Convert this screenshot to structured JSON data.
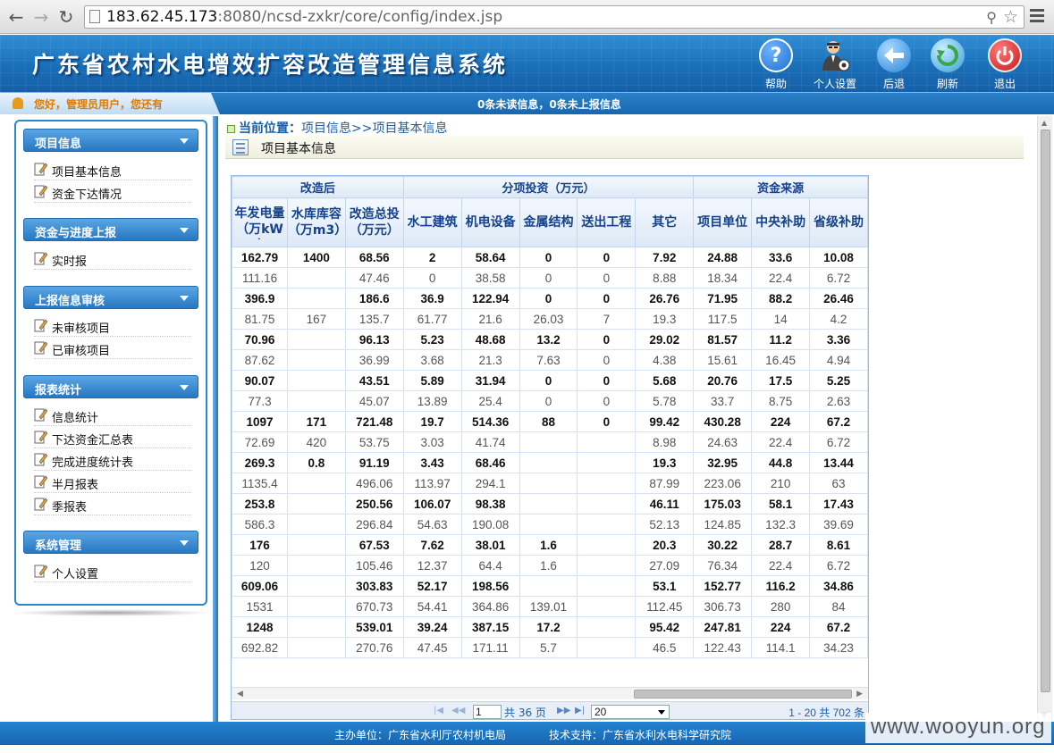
{
  "browser": {
    "url_host": "183.62.45.173",
    "url_rest": ":8080/ncsd-zxkr/core/config/index.jsp"
  },
  "header": {
    "title": "广东省农村水电增效扩容改造管理信息系统",
    "buttons": [
      {
        "label": "帮助",
        "icon": "help-icon"
      },
      {
        "label": "个人设置",
        "icon": "user-settings-icon"
      },
      {
        "label": "后退",
        "icon": "back-arrow-icon"
      },
      {
        "label": "刷新",
        "icon": "refresh-icon"
      },
      {
        "label": "退出",
        "icon": "power-icon"
      }
    ],
    "colors": {
      "help": "#1f6fd0",
      "settings": "#444444",
      "back": "#2a86d8",
      "refresh": "#3aa0d8",
      "exit": "#d42020"
    }
  },
  "userbar": {
    "greeting": "您好，管理员用户，您还有",
    "notice": "0条未读信息，0条未上报信息"
  },
  "sidebar": {
    "sections": [
      {
        "title": "项目信息",
        "items": [
          "项目基本信息",
          "资金下达情况"
        ]
      },
      {
        "title": "资金与进度上报",
        "items": [
          "实时报"
        ]
      },
      {
        "title": "上报信息审核",
        "items": [
          "未审核项目",
          "已审核项目"
        ]
      },
      {
        "title": "报表统计",
        "items": [
          "信息统计",
          "下达资金汇总表",
          "完成进度统计表",
          "半月报表",
          "季报表"
        ]
      },
      {
        "title": "系统管理",
        "items": [
          "个人设置"
        ]
      }
    ]
  },
  "main": {
    "breadcrumb_label": "当前位置：",
    "breadcrumb_path": "项目信息>>项目基本信息",
    "page_title": "项目基本信息"
  },
  "table": {
    "group_headers": [
      {
        "label": "改造后",
        "span": 3
      },
      {
        "label": "分项投资（万元）",
        "span": 5
      },
      {
        "label": "资金来源",
        "span": 3
      }
    ],
    "columns": [
      "年发电量（万kWh）",
      "水库库容（万m3）",
      "改造总投（万元）",
      "水工建筑",
      "机电设备",
      "金属结构",
      "送出工程",
      "其它",
      "项目单位",
      "中央补助",
      "省级补助"
    ],
    "rows": [
      [
        "162.79",
        "1400",
        "68.56",
        "2",
        "58.64",
        "0",
        "0",
        "7.92",
        "24.88",
        "33.6",
        "10.08"
      ],
      [
        "111.16",
        "",
        "47.46",
        "0",
        "38.58",
        "0",
        "0",
        "8.88",
        "18.34",
        "22.4",
        "6.72"
      ],
      [
        "396.9",
        "",
        "186.6",
        "36.9",
        "122.94",
        "0",
        "0",
        "26.76",
        "71.95",
        "88.2",
        "26.46"
      ],
      [
        "81.75",
        "167",
        "135.7",
        "61.77",
        "21.6",
        "26.03",
        "7",
        "19.3",
        "117.5",
        "14",
        "4.2"
      ],
      [
        "70.96",
        "",
        "96.13",
        "5.23",
        "48.68",
        "13.2",
        "0",
        "29.02",
        "81.57",
        "11.2",
        "3.36"
      ],
      [
        "87.62",
        "",
        "36.99",
        "3.68",
        "21.3",
        "7.63",
        "0",
        "4.38",
        "15.61",
        "16.45",
        "4.94"
      ],
      [
        "90.07",
        "",
        "43.51",
        "5.89",
        "31.94",
        "0",
        "0",
        "5.68",
        "20.76",
        "17.5",
        "5.25"
      ],
      [
        "77.3",
        "",
        "45.07",
        "13.89",
        "25.4",
        "0",
        "0",
        "5.78",
        "33.7",
        "8.75",
        "2.63"
      ],
      [
        "1097",
        "171",
        "721.48",
        "19.7",
        "514.36",
        "88",
        "0",
        "99.42",
        "430.28",
        "224",
        "67.2"
      ],
      [
        "72.69",
        "420",
        "53.75",
        "3.03",
        "41.74",
        "",
        "",
        "8.98",
        "24.63",
        "22.4",
        "6.72"
      ],
      [
        "269.3",
        "0.8",
        "91.19",
        "3.43",
        "68.46",
        "",
        "",
        "19.3",
        "32.95",
        "44.8",
        "13.44"
      ],
      [
        "1135.4",
        "",
        "496.06",
        "113.97",
        "294.1",
        "",
        "",
        "87.99",
        "223.06",
        "210",
        "63"
      ],
      [
        "253.8",
        "",
        "250.56",
        "106.07",
        "98.38",
        "",
        "",
        "46.11",
        "175.03",
        "58.1",
        "17.43"
      ],
      [
        "586.3",
        "",
        "296.84",
        "54.63",
        "190.08",
        "",
        "",
        "52.13",
        "124.85",
        "132.3",
        "39.69"
      ],
      [
        "176",
        "",
        "67.53",
        "7.62",
        "38.01",
        "1.6",
        "",
        "20.3",
        "30.22",
        "28.7",
        "8.61"
      ],
      [
        "120",
        "",
        "105.46",
        "12.37",
        "64.4",
        "1.6",
        "",
        "27.09",
        "76.34",
        "22.4",
        "6.72"
      ],
      [
        "609.06",
        "",
        "303.83",
        "52.17",
        "198.56",
        "",
        "",
        "53.1",
        "152.77",
        "116.2",
        "34.86"
      ],
      [
        "1531",
        "",
        "670.73",
        "54.41",
        "364.86",
        "139.01",
        "",
        "112.45",
        "306.73",
        "280",
        "84"
      ],
      [
        "1248",
        "",
        "539.01",
        "39.24",
        "387.15",
        "17.2",
        "",
        "95.42",
        "247.81",
        "224",
        "67.2"
      ],
      [
        "692.82",
        "",
        "270.76",
        "47.45",
        "171.11",
        "5.7",
        "",
        "46.5",
        "122.43",
        "114.1",
        "34.23"
      ]
    ]
  },
  "pager": {
    "current_page": "1",
    "total_pages_text": "共 36 页",
    "page_size": "20",
    "info": "1 - 20  共 702 条"
  },
  "footer": {
    "sponsor": "主办单位：广东省水利厅农村机电局",
    "support": "技术支持：广东省水利水电科学研究院"
  },
  "watermark": "www.wooyun.org"
}
